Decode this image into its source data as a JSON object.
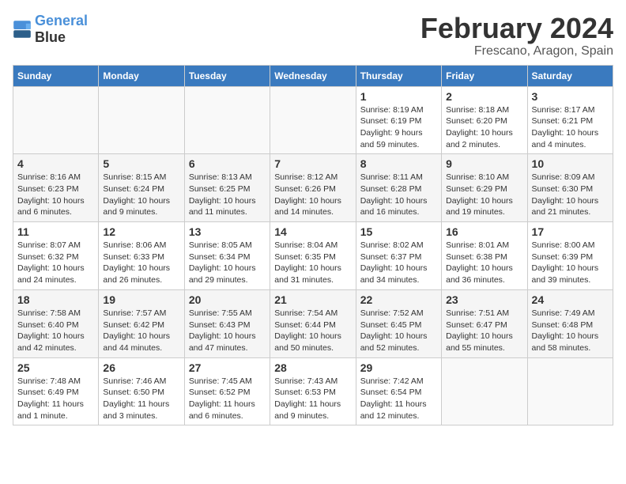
{
  "header": {
    "logo_line1": "General",
    "logo_line2": "Blue",
    "month_year": "February 2024",
    "location": "Frescano, Aragon, Spain"
  },
  "weekdays": [
    "Sunday",
    "Monday",
    "Tuesday",
    "Wednesday",
    "Thursday",
    "Friday",
    "Saturday"
  ],
  "weeks": [
    [
      {
        "day": "",
        "info": ""
      },
      {
        "day": "",
        "info": ""
      },
      {
        "day": "",
        "info": ""
      },
      {
        "day": "",
        "info": ""
      },
      {
        "day": "1",
        "info": "Sunrise: 8:19 AM\nSunset: 6:19 PM\nDaylight: 9 hours\nand 59 minutes."
      },
      {
        "day": "2",
        "info": "Sunrise: 8:18 AM\nSunset: 6:20 PM\nDaylight: 10 hours\nand 2 minutes."
      },
      {
        "day": "3",
        "info": "Sunrise: 8:17 AM\nSunset: 6:21 PM\nDaylight: 10 hours\nand 4 minutes."
      }
    ],
    [
      {
        "day": "4",
        "info": "Sunrise: 8:16 AM\nSunset: 6:23 PM\nDaylight: 10 hours\nand 6 minutes."
      },
      {
        "day": "5",
        "info": "Sunrise: 8:15 AM\nSunset: 6:24 PM\nDaylight: 10 hours\nand 9 minutes."
      },
      {
        "day": "6",
        "info": "Sunrise: 8:13 AM\nSunset: 6:25 PM\nDaylight: 10 hours\nand 11 minutes."
      },
      {
        "day": "7",
        "info": "Sunrise: 8:12 AM\nSunset: 6:26 PM\nDaylight: 10 hours\nand 14 minutes."
      },
      {
        "day": "8",
        "info": "Sunrise: 8:11 AM\nSunset: 6:28 PM\nDaylight: 10 hours\nand 16 minutes."
      },
      {
        "day": "9",
        "info": "Sunrise: 8:10 AM\nSunset: 6:29 PM\nDaylight: 10 hours\nand 19 minutes."
      },
      {
        "day": "10",
        "info": "Sunrise: 8:09 AM\nSunset: 6:30 PM\nDaylight: 10 hours\nand 21 minutes."
      }
    ],
    [
      {
        "day": "11",
        "info": "Sunrise: 8:07 AM\nSunset: 6:32 PM\nDaylight: 10 hours\nand 24 minutes."
      },
      {
        "day": "12",
        "info": "Sunrise: 8:06 AM\nSunset: 6:33 PM\nDaylight: 10 hours\nand 26 minutes."
      },
      {
        "day": "13",
        "info": "Sunrise: 8:05 AM\nSunset: 6:34 PM\nDaylight: 10 hours\nand 29 minutes."
      },
      {
        "day": "14",
        "info": "Sunrise: 8:04 AM\nSunset: 6:35 PM\nDaylight: 10 hours\nand 31 minutes."
      },
      {
        "day": "15",
        "info": "Sunrise: 8:02 AM\nSunset: 6:37 PM\nDaylight: 10 hours\nand 34 minutes."
      },
      {
        "day": "16",
        "info": "Sunrise: 8:01 AM\nSunset: 6:38 PM\nDaylight: 10 hours\nand 36 minutes."
      },
      {
        "day": "17",
        "info": "Sunrise: 8:00 AM\nSunset: 6:39 PM\nDaylight: 10 hours\nand 39 minutes."
      }
    ],
    [
      {
        "day": "18",
        "info": "Sunrise: 7:58 AM\nSunset: 6:40 PM\nDaylight: 10 hours\nand 42 minutes."
      },
      {
        "day": "19",
        "info": "Sunrise: 7:57 AM\nSunset: 6:42 PM\nDaylight: 10 hours\nand 44 minutes."
      },
      {
        "day": "20",
        "info": "Sunrise: 7:55 AM\nSunset: 6:43 PM\nDaylight: 10 hours\nand 47 minutes."
      },
      {
        "day": "21",
        "info": "Sunrise: 7:54 AM\nSunset: 6:44 PM\nDaylight: 10 hours\nand 50 minutes."
      },
      {
        "day": "22",
        "info": "Sunrise: 7:52 AM\nSunset: 6:45 PM\nDaylight: 10 hours\nand 52 minutes."
      },
      {
        "day": "23",
        "info": "Sunrise: 7:51 AM\nSunset: 6:47 PM\nDaylight: 10 hours\nand 55 minutes."
      },
      {
        "day": "24",
        "info": "Sunrise: 7:49 AM\nSunset: 6:48 PM\nDaylight: 10 hours\nand 58 minutes."
      }
    ],
    [
      {
        "day": "25",
        "info": "Sunrise: 7:48 AM\nSunset: 6:49 PM\nDaylight: 11 hours\nand 1 minute."
      },
      {
        "day": "26",
        "info": "Sunrise: 7:46 AM\nSunset: 6:50 PM\nDaylight: 11 hours\nand 3 minutes."
      },
      {
        "day": "27",
        "info": "Sunrise: 7:45 AM\nSunset: 6:52 PM\nDaylight: 11 hours\nand 6 minutes."
      },
      {
        "day": "28",
        "info": "Sunrise: 7:43 AM\nSunset: 6:53 PM\nDaylight: 11 hours\nand 9 minutes."
      },
      {
        "day": "29",
        "info": "Sunrise: 7:42 AM\nSunset: 6:54 PM\nDaylight: 11 hours\nand 12 minutes."
      },
      {
        "day": "",
        "info": ""
      },
      {
        "day": "",
        "info": ""
      }
    ]
  ]
}
